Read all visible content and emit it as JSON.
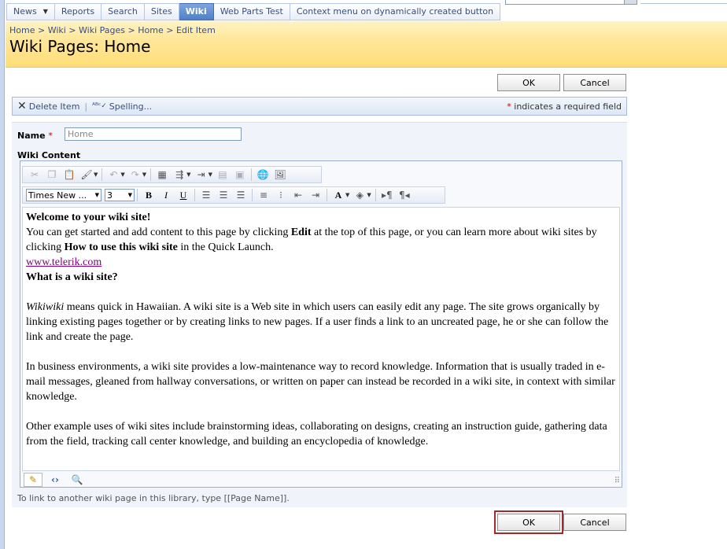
{
  "topnav": {
    "tabs": [
      {
        "label": "News",
        "has_menu": true,
        "active": false
      },
      {
        "label": "Reports",
        "active": false
      },
      {
        "label": "Search",
        "active": false
      },
      {
        "label": "Sites",
        "active": false
      },
      {
        "label": "Wiki",
        "active": true
      },
      {
        "label": "Web Parts Test",
        "active": false
      },
      {
        "label": "Context menu on dynamically created button",
        "active": false
      }
    ]
  },
  "breadcrumb": [
    "Home",
    "Wiki",
    "Wiki Pages",
    "Home",
    "Edit Item"
  ],
  "breadcrumb_separator": ">",
  "page_title": "Wiki Pages: Home",
  "buttons": {
    "ok": "OK",
    "cancel": "Cancel"
  },
  "action_bar": {
    "delete_label": "Delete Item",
    "spelling_label": "Spelling...",
    "required_star": "*",
    "required_text": "indicates a required field"
  },
  "form": {
    "name_label": "Name",
    "name_value": "Home",
    "wiki_content_label": "Wiki Content"
  },
  "editor": {
    "font_name": "Times New ...",
    "font_size": "3",
    "content": {
      "heading1": "Welcome to your wiki site!",
      "p1_a": "You can get started and add content to this page by clicking ",
      "p1_bold1": "Edit",
      "p1_b": " at the top of this page, or you can learn more about wiki sites by clicking ",
      "p1_bold2": "How to use this wiki site",
      "p1_c": " in the Quick Launch.",
      "link": "www.telerik.com",
      "heading2": "What is a wiki site?",
      "p2_italic": "Wikiwiki",
      "p2_rest": " means quick in Hawaiian. A wiki site is a Web site in which users can easily edit any page. The site grows organically by linking existing pages together or by creating links to new pages. If a user finds a link to an uncreated page, he or she can follow the link and create the page.",
      "p3": "In business environments, a wiki site provides a low-maintenance way to record knowledge. Information that is usually traded in e-mail messages, gleaned from hallway conversations, or written on paper can instead be recorded in a wiki site, in context with similar knowledge.",
      "p4": "Other example uses of wiki sites include brainstorming ideas, collaborating on designs, creating an instruction guide, gathering data from the field, tracking call center knowledge, and building an encyclopedia of knowledge."
    }
  },
  "hint": "To link to another wiki page in this library, type [[Page Name]].",
  "colors": {
    "header_bg": "#ffe79a",
    "accent_blue": "#3a4e7b",
    "required_red": "#cc0000",
    "focus_outline": "#a12b2b"
  }
}
